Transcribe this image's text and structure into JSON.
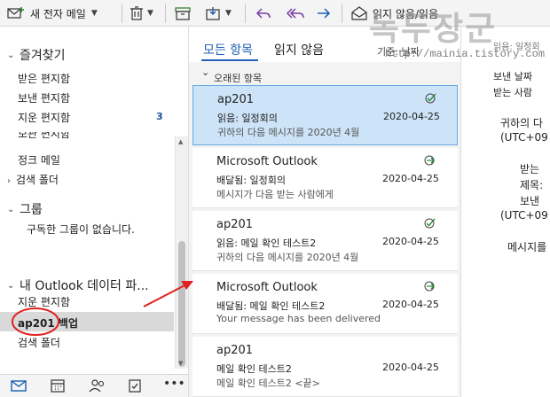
{
  "toolbar": {
    "new_email": "새 전자 메일",
    "read_unread": "읽지 않음/읽음"
  },
  "nav": {
    "favorites": {
      "header": "즐겨찾기",
      "items": [
        {
          "label": "받은 편지함"
        },
        {
          "label": "보낸 편지함"
        },
        {
          "label": "지운 편지함",
          "count": "3"
        }
      ]
    },
    "folders": [
      {
        "label": "보관 편지함"
      },
      {
        "label": "정크 메일"
      },
      {
        "label": "검색 폴더"
      }
    ],
    "groups": {
      "header": "그룹",
      "empty_text": "구독한 그룹이 없습니다."
    },
    "datafile": {
      "header": "내 Outlook 데이터 파...",
      "items": [
        {
          "label": "지운 편지함"
        },
        {
          "label": "ap201 백업"
        },
        {
          "label": "검색 폴더"
        }
      ]
    }
  },
  "list": {
    "tabs": [
      {
        "label": "모든 항목"
      },
      {
        "label": "읽지 않음"
      }
    ],
    "sort_label": "기준: 날짜",
    "group_label": "오래된 항목",
    "messages": [
      {
        "sender": "ap201",
        "subject": "읽음: 일정회의",
        "date": "2020-04-25",
        "preview": "귀하의 다음 메시지를 2020년 4월",
        "status_icon": "read-receipt-icon"
      },
      {
        "sender": "Microsoft Outlook",
        "subject": "배달됨: 일정회의",
        "date": "2020-04-25",
        "preview": "메시지가 다음 받는 사람에게",
        "status_icon": "delivery-receipt-icon"
      },
      {
        "sender": "ap201",
        "subject": "읽음: 메일 확인 테스트2",
        "date": "2020-04-25",
        "preview": "귀하의 다음 메시지를 2020년 4월",
        "status_icon": "read-receipt-icon"
      },
      {
        "sender": "Microsoft Outlook",
        "subject": "배달됨: 메일 확인 테스트2",
        "date": "2020-04-25",
        "preview": "Your message has been delivered",
        "status_icon": "delivery-receipt-icon"
      },
      {
        "sender": "ap201",
        "subject": "메일 확인 테스트2",
        "date": "2020-04-25",
        "preview": "메일 확인 테스트2 <끝>",
        "status_icon": ""
      }
    ]
  },
  "reading": {
    "lines": [
      "읽음: 일정회",
      "보낸 날짜",
      "받는 사람",
      "귀하의 다",
      "(UTC+09",
      "받는",
      "제목:",
      "보낸",
      "(UTC+09",
      "메시지를"
    ]
  },
  "watermark": {
    "title": "녹두장군",
    "url": "http://mainia.tistory.com"
  },
  "colors": {
    "accent": "#1a5fb4",
    "selected_bg": "#cde3f7",
    "annotation": "#e02020"
  }
}
